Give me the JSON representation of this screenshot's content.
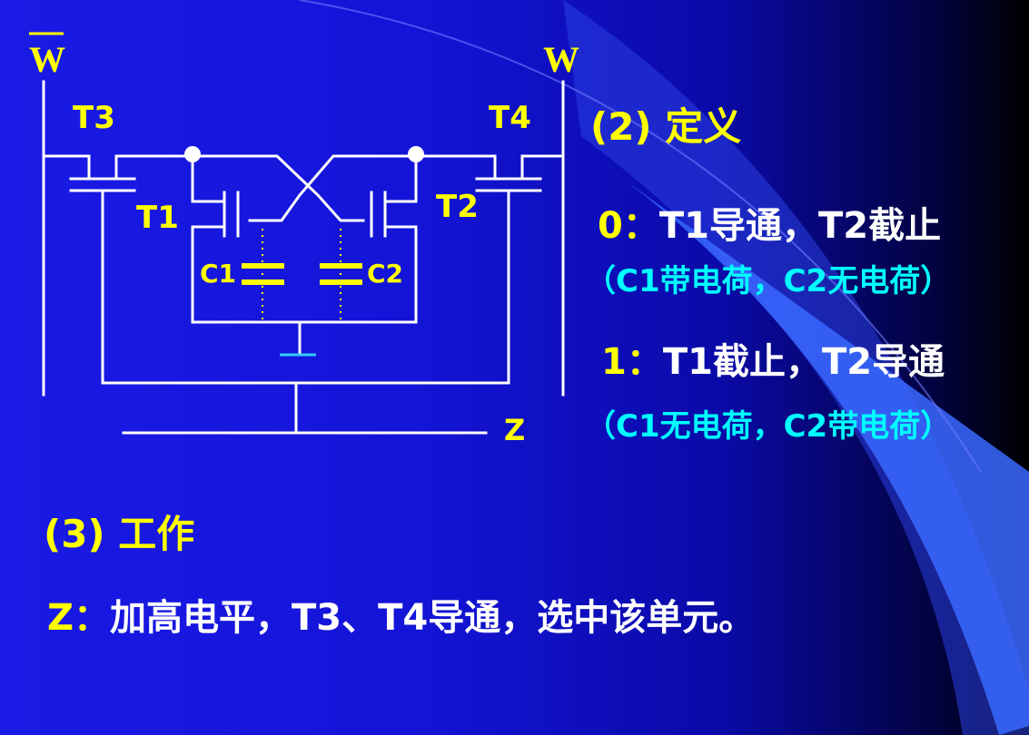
{
  "diagram": {
    "labels": {
      "wbar": "W",
      "w": "W",
      "t1": "T1",
      "t2": "T2",
      "t3": "T3",
      "t4": "T4",
      "c1": "C1",
      "c2": "C2",
      "z": "Z"
    }
  },
  "definition": {
    "heading": "(2) 定义",
    "state0": {
      "key": "0：",
      "text": "T1导通，T2截止",
      "note": "（C1带电荷，C2无电荷）"
    },
    "state1": {
      "key": "1：",
      "text": "T1截止，T2导通",
      "note": "（C1无电荷，C2带电荷）"
    }
  },
  "work": {
    "heading": "(3) 工作",
    "key": "Z：",
    "text": "加高电平，T3、T4导通，选中该单元。"
  },
  "colors": {
    "yellow": "#ffff00",
    "white": "#ffffff",
    "cyan": "#00ffff",
    "background": "#1414d8"
  }
}
